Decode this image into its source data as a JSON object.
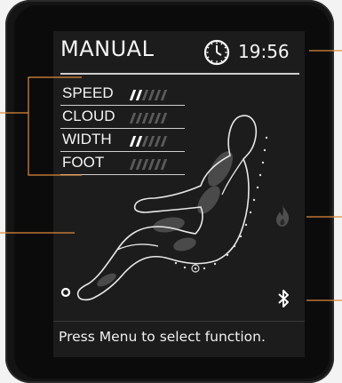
{
  "screen": {
    "title": "MANUAL",
    "clock_icon": "clock-icon",
    "time": "19:56",
    "footer": "Press Menu to select function."
  },
  "params": [
    {
      "label": "SPEED",
      "level": 2,
      "max": 6
    },
    {
      "label": "CLOUD",
      "level": 0,
      "max": 6
    },
    {
      "label": "WIDTH",
      "level": 2,
      "max": 6
    },
    {
      "label": "FOOT",
      "level": 0,
      "max": 6
    }
  ],
  "icons": {
    "heat": "flame-icon",
    "bluetooth": "bluetooth-icon",
    "position": "ring-icon"
  },
  "colors": {
    "screen_bg": "#1c1c1c",
    "bezel": "#141414",
    "text": "#f5f5f5",
    "callout": "#e08a3c",
    "bar_on": "#ffffff",
    "bar_off": "#5a5a5a"
  }
}
